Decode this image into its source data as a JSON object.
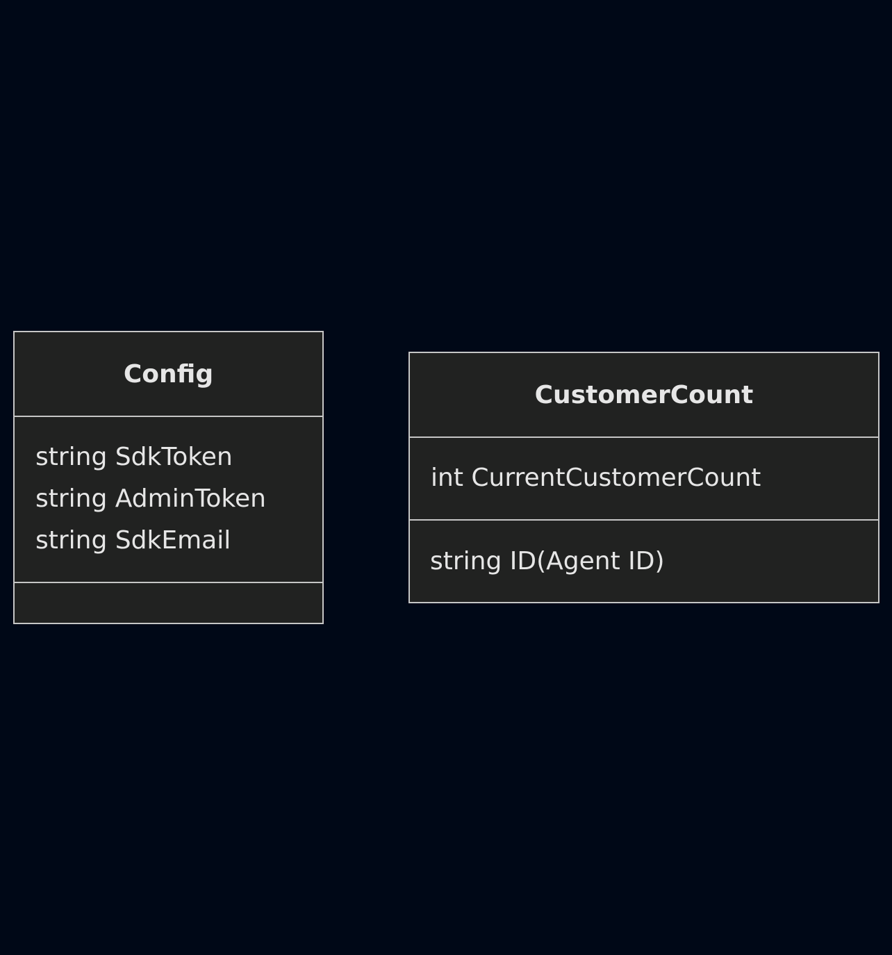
{
  "classes": [
    {
      "name": "Config",
      "attributes": [
        "string SdkToken",
        "string AdminToken",
        "string SdkEmail"
      ],
      "methods": []
    },
    {
      "name": "CustomerCount",
      "attributes": [
        "int CurrentCustomerCount"
      ],
      "methods": [
        "string ID(Agent ID)"
      ]
    }
  ],
  "colors": {
    "background": "#000817",
    "box_fill": "#212221",
    "box_border": "#c6c6c6",
    "text": "#e6e6e6"
  }
}
